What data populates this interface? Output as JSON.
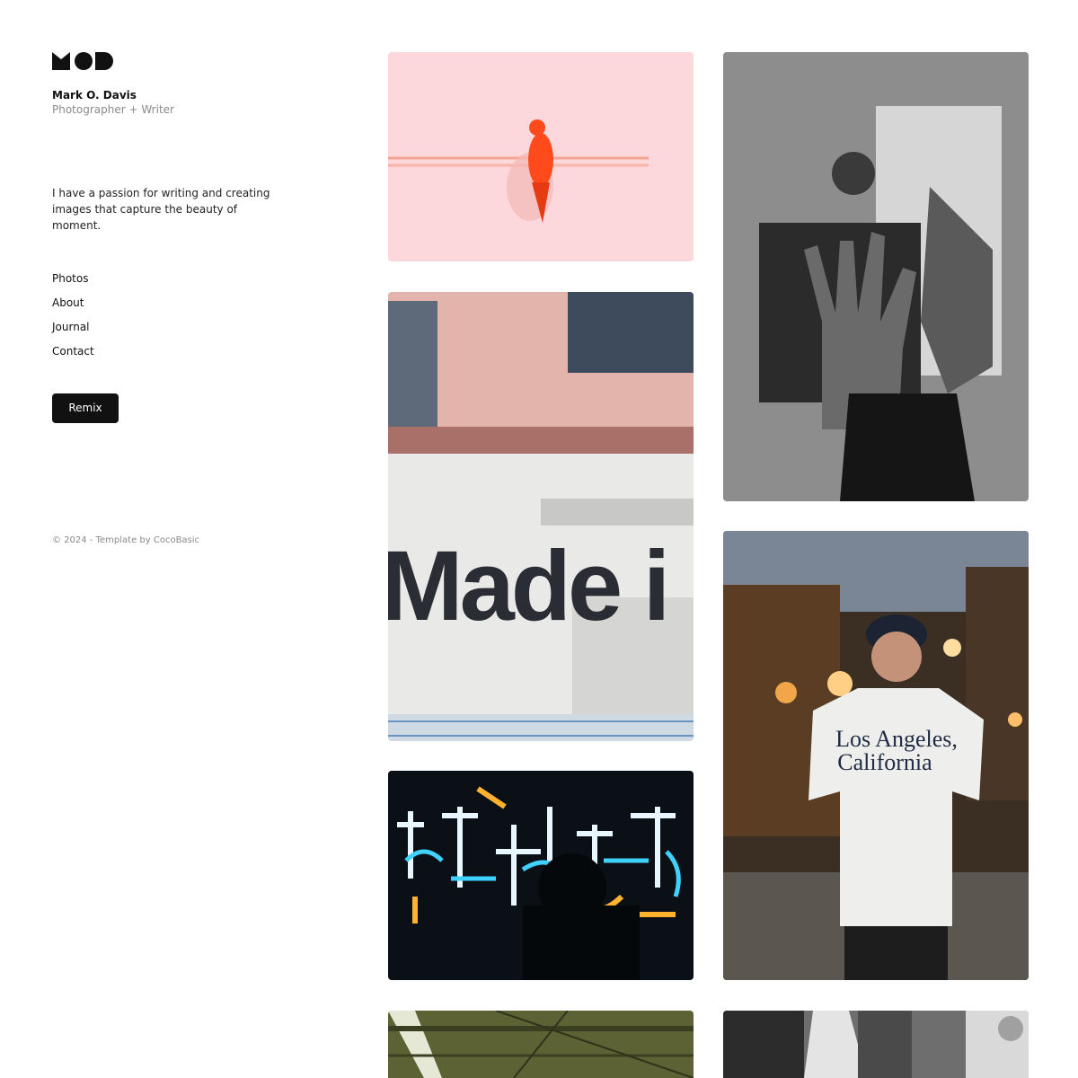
{
  "brand": {
    "logo_text": "MOD"
  },
  "profile": {
    "name": "Mark O. Davis",
    "role": "Photographer + Writer"
  },
  "bio": "I have a passion for writing and creating images that capture the beauty of moment.",
  "nav": [
    "Photos",
    "About",
    "Journal",
    "Contact"
  ],
  "cta": {
    "remix_label": "Remix"
  },
  "footer": {
    "copyright": "© 2024 - Template by CocoBasic"
  },
  "photos": {
    "bird_on_wire": "bird-on-wire-photo",
    "made_in_wall": {
      "sign_text": "Made i"
    },
    "raised_hand": "raised-hand-photo",
    "neon_sign": "neon-sign-photo",
    "los_angeles_shirt": {
      "shirt_text_line1": "Los Angeles,",
      "shirt_text_line2": "California"
    },
    "warehouse_roof": "warehouse-roof-photo",
    "monochrome_still": "monochrome-still-photo"
  },
  "colors": {
    "accent": "#111111",
    "muted": "#8a8a8a",
    "bird": "#ff4a1c",
    "pink_bg": "#fcd8dc"
  }
}
